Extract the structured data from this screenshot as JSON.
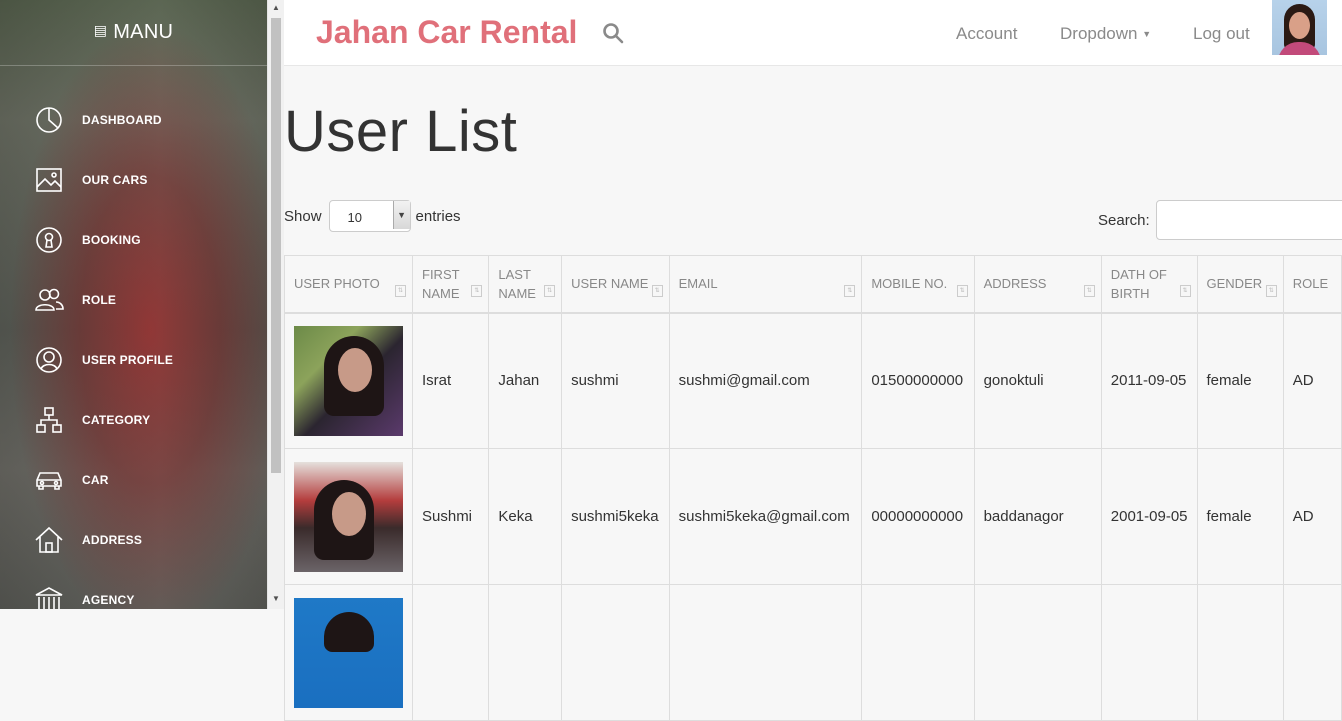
{
  "sidebar": {
    "menu_title": "MANU",
    "items": [
      {
        "label": "DASHBOARD",
        "icon": "pie-chart-icon"
      },
      {
        "label": "OUR CARS",
        "icon": "image-icon"
      },
      {
        "label": "BOOKING",
        "icon": "keyhole-icon"
      },
      {
        "label": "ROLE",
        "icon": "users-icon"
      },
      {
        "label": "USER PROFILE",
        "icon": "user-circle-icon"
      },
      {
        "label": "CATEGORY",
        "icon": "hierarchy-icon"
      },
      {
        "label": "CAR",
        "icon": "car-icon"
      },
      {
        "label": "ADDRESS",
        "icon": "home-icon"
      },
      {
        "label": "AGENCY",
        "icon": "bank-icon"
      }
    ]
  },
  "header": {
    "brand": "Jahan Car Rental",
    "nav": {
      "account": "Account",
      "dropdown": "Dropdown",
      "logout": "Log out"
    }
  },
  "main": {
    "title": "User List",
    "show_label": "Show",
    "entries_value": "10",
    "entries_label": "entries",
    "search_label": "Search:",
    "search_value": ""
  },
  "table": {
    "columns": [
      "USER PHOTO",
      "FIRST NAME",
      "LAST NAME",
      "USER NAME",
      "EMAIL",
      "MOBILE NO.",
      "ADDRESS",
      "DATH OF BIRTH",
      "GENDER",
      "ROLE"
    ],
    "rows": [
      {
        "first": "Israt",
        "last": "Jahan",
        "user": "sushmi",
        "email": "sushmi@gmail.com",
        "mobile": "01500000000",
        "address": "gonoktuli",
        "dob": "2011-09-05",
        "gender": "female",
        "role": "AD"
      },
      {
        "first": "Sushmi",
        "last": "Keka",
        "user": "sushmi5keka",
        "email": "sushmi5keka@gmail.com",
        "mobile": "00000000000",
        "address": "baddanagor",
        "dob": "2001-09-05",
        "gender": "female",
        "role": "AD"
      },
      {
        "first": "",
        "last": "",
        "user": "",
        "email": "",
        "mobile": "",
        "address": "",
        "dob": "",
        "gender": "",
        "role": ""
      }
    ]
  },
  "colors": {
    "brand": "#e0707a",
    "nav_text": "#8a8a8a",
    "sidebar_text": "#ffffff"
  }
}
